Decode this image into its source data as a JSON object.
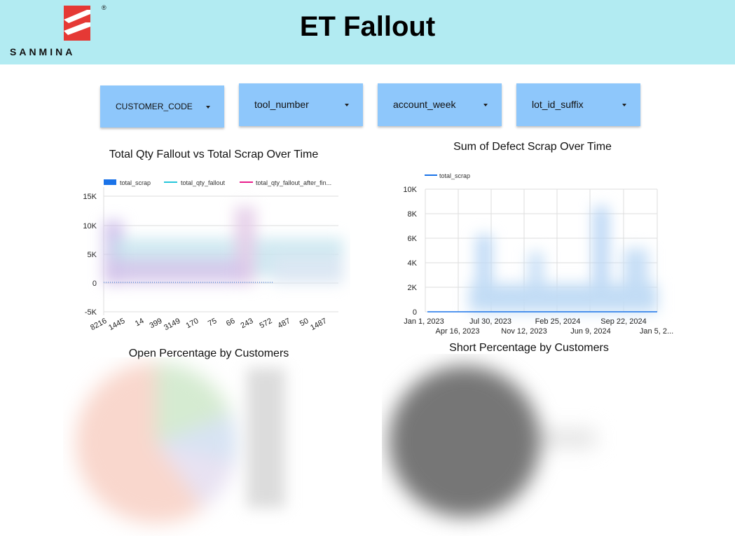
{
  "header": {
    "title": "ET Fallout",
    "logo_text": "SANMINA",
    "logo_mark": "®",
    "background_color": "#b2ebf2"
  },
  "filters": [
    {
      "label": "CUSTOMER_CODE"
    },
    {
      "label": "tool_number"
    },
    {
      "label": "account_week"
    },
    {
      "label": "lot_id_suffix"
    }
  ],
  "charts": {
    "fallout": {
      "title": "Total Qty Fallout vs Total Scrap Over Time"
    },
    "defect": {
      "title": "Sum of Defect Scrap Over Time"
    },
    "open_pct": {
      "title": "Open Percentage by Customers"
    },
    "short_pct": {
      "title": "Short Percentage by Customers"
    }
  },
  "chart_data": [
    {
      "type": "bar",
      "title": "Total Qty Fallout vs Total Scrap Over Time",
      "legend": [
        "total_scrap",
        "total_qty_fallout",
        "total_qty_fallout_after_fin..."
      ],
      "legend_position": "top",
      "series_colors": {
        "total_scrap": "#1a73e8",
        "total_qty_fallout": "#26c6da",
        "total_qty_fallout_after_fin...": "#e91e8c"
      },
      "y_ticks": [
        "15K",
        "10K",
        "5K",
        "0",
        "-5K"
      ],
      "ylim": [
        -5000,
        15000
      ],
      "categories": [
        "8216",
        "1445",
        "14",
        "399",
        "3149",
        "170",
        "75",
        "66",
        "243",
        "572",
        "487",
        "50",
        "1487"
      ],
      "grid": true
    },
    {
      "type": "line",
      "title": "Sum of Defect Scrap Over Time",
      "legend": [
        "total_scrap"
      ],
      "legend_position": "top-left",
      "series_colors": {
        "total_scrap": "#1a73e8"
      },
      "y_ticks": [
        "10K",
        "8K",
        "6K",
        "4K",
        "2K",
        "0"
      ],
      "ylim": [
        0,
        10000
      ],
      "x_ticks_row1": [
        "Jan 1, 2023",
        "Jul 30, 2023",
        "Feb 25, 2024",
        "Sep 22, 2024"
      ],
      "x_ticks_row2": [
        "Apr 16, 2023",
        "Nov 12, 2023",
        "Jun 9, 2024",
        "Jan 5, 2..."
      ],
      "grid": true
    },
    {
      "type": "pie",
      "title": "Open Percentage by Customers",
      "legend_position": "right"
    },
    {
      "type": "pie",
      "title": "Short Percentage by Customers"
    }
  ]
}
